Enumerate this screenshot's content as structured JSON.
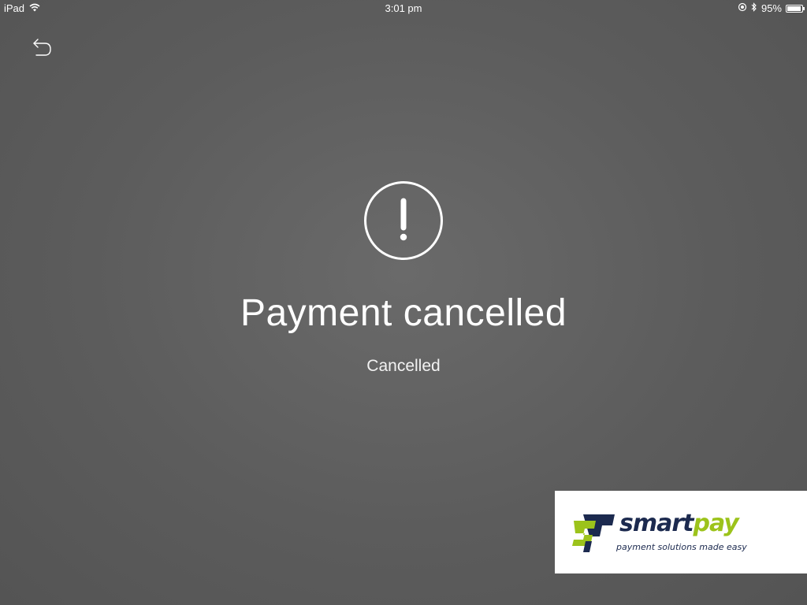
{
  "status_bar": {
    "device": "iPad",
    "time": "3:01 pm",
    "battery_percent_label": "95%",
    "battery_level": 0.95,
    "icons": [
      "wifi-icon",
      "orientation-lock-icon",
      "bluetooth-icon",
      "battery-icon"
    ]
  },
  "navigation": {
    "back_icon": "undo-arrow-icon"
  },
  "result": {
    "icon": "exclamation-circle-icon",
    "title": "Payment cancelled",
    "status": "Cancelled"
  },
  "branding": {
    "wordmark_part1": "smart",
    "wordmark_part2": "pay",
    "tagline": "payment solutions made easy",
    "colors": {
      "navy": "#1c2a4f",
      "green": "#9cc31b"
    }
  },
  "colors": {
    "background": "#5e5e5e",
    "foreground": "#ffffff"
  }
}
